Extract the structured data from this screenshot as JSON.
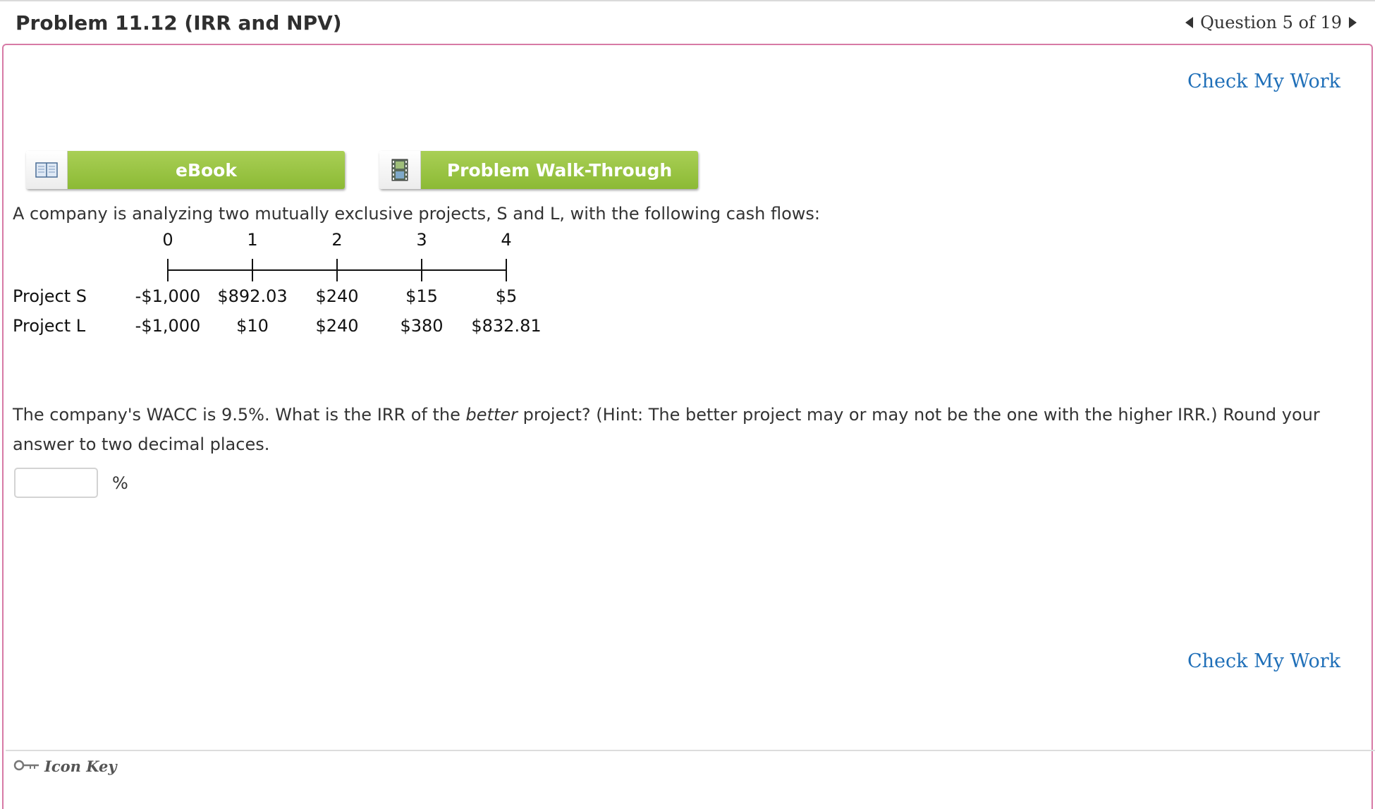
{
  "header": {
    "title": "Problem 11.12 (IRR and NPV)",
    "question_nav": "Question 5 of 19"
  },
  "actions": {
    "check_my_work": "Check My Work"
  },
  "tools": {
    "ebook_label": "eBook",
    "walkthrough_label": "Problem Walk-Through"
  },
  "question": {
    "intro": "A company is analyzing two mutually exclusive projects, S and L, with the following cash flows:",
    "periods": [
      "0",
      "1",
      "2",
      "3",
      "4"
    ],
    "projects": [
      {
        "label": "Project S",
        "cash_flows": [
          "-$1,000",
          "$892.03",
          "$240",
          "$15",
          "$5"
        ]
      },
      {
        "label": "Project L",
        "cash_flows": [
          "-$1,000",
          "$10",
          "$240",
          "$380",
          "$832.81"
        ]
      }
    ],
    "body_part1": "The company's WACC is 9.5%. What is the IRR of the ",
    "body_emph": "better",
    "body_part2": " project? (Hint: The better project may or may not be the one with the higher IRR.) Round your answer to two decimal places.",
    "answer_value": "",
    "answer_unit": "%"
  },
  "footer": {
    "icon_key_label": "Icon Key"
  },
  "colors": {
    "accent_border": "#d77aa6",
    "link": "#1f6fb8",
    "button_green": "#8cba35"
  }
}
